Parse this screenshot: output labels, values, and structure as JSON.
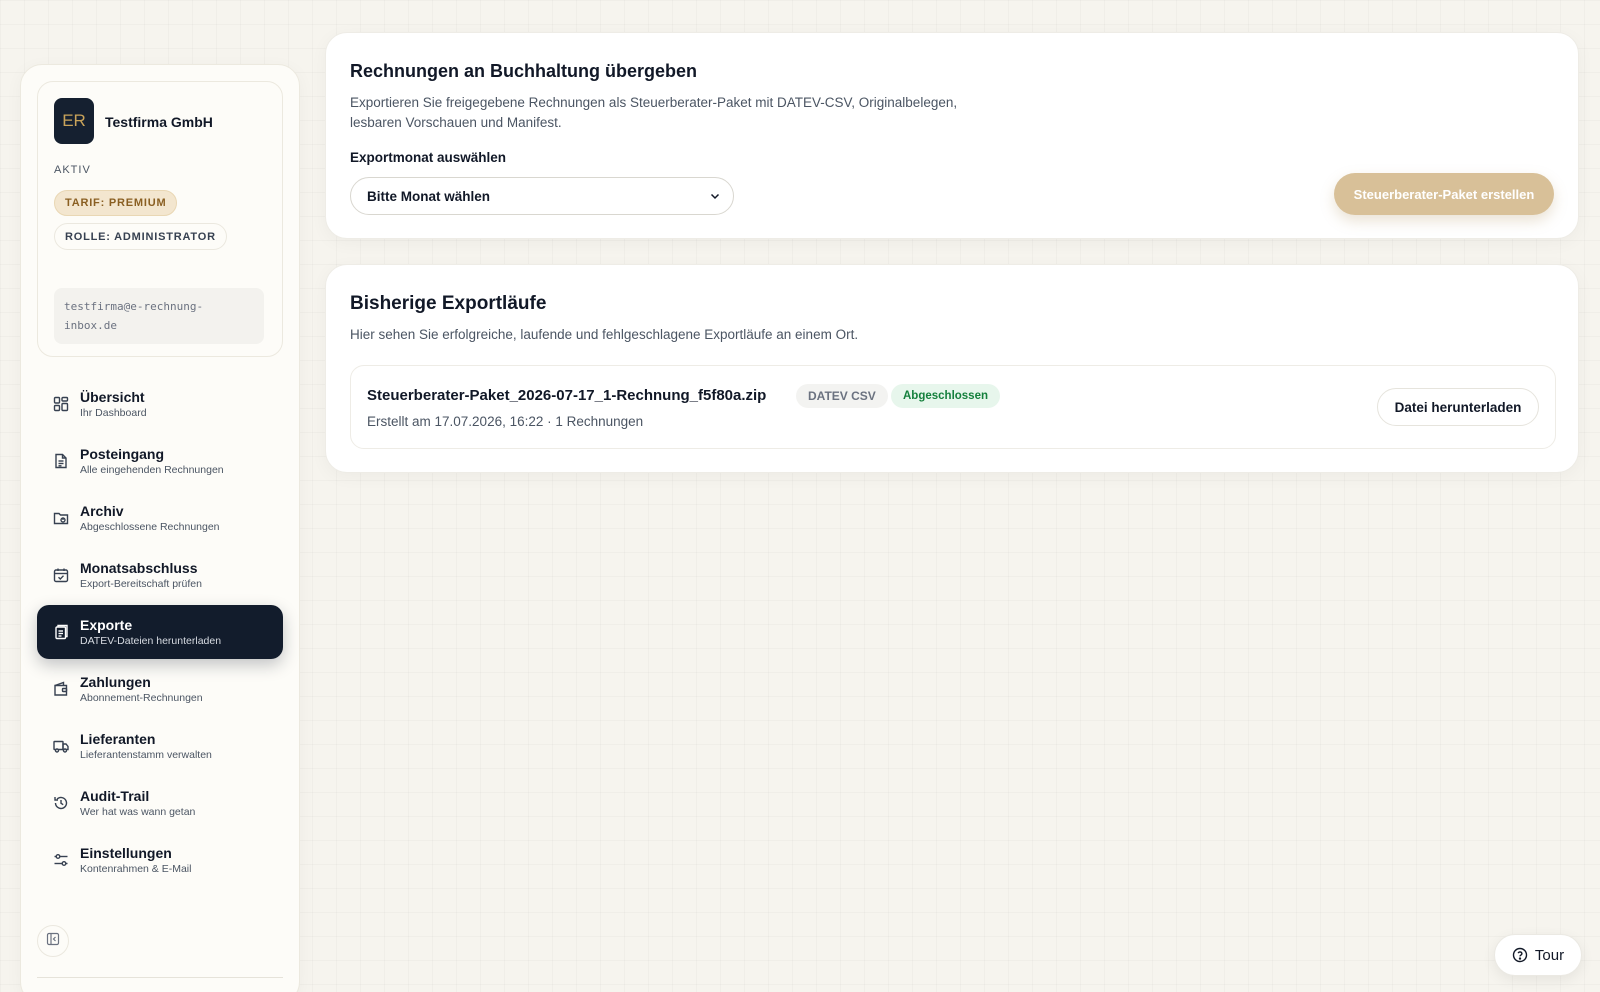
{
  "profile": {
    "initials": "ER",
    "company": "Testfirma GmbH",
    "status": "AKTIV",
    "tarif": "TARIF: PREMIUM",
    "rolle": "ROLLE: ADMINISTRATOR",
    "email": "testfirma@e-rechnung-inbox.de"
  },
  "nav": [
    {
      "title": "Übersicht",
      "sub": "Ihr Dashboard",
      "icon": "dashboard-icon"
    },
    {
      "title": "Posteingang",
      "sub": "Alle eingehenden Rechnungen",
      "icon": "document-icon"
    },
    {
      "title": "Archiv",
      "sub": "Abgeschlossene Rechnungen",
      "icon": "folder-icon"
    },
    {
      "title": "Monatsabschluss",
      "sub": "Export-Bereitschaft prüfen",
      "icon": "calendar-check-icon"
    },
    {
      "title": "Exporte",
      "sub": "DATEV-Dateien herunterladen",
      "icon": "export-files-icon"
    },
    {
      "title": "Zahlungen",
      "sub": "Abonnement-Rechnungen",
      "icon": "wallet-icon"
    },
    {
      "title": "Lieferanten",
      "sub": "Lieferantenstamm verwalten",
      "icon": "truck-icon"
    },
    {
      "title": "Audit-Trail",
      "sub": "Wer hat was wann getan",
      "icon": "history-icon"
    },
    {
      "title": "Einstellungen",
      "sub": "Kontenrahmen & E-Mail",
      "icon": "sliders-icon"
    }
  ],
  "export_card": {
    "title": "Rechnungen an Buchhaltung übergeben",
    "description": "Exportieren Sie freigegebene Rechnungen als Steuerberater-Paket mit DATEV-CSV, Originalbelegen, lesbaren Vorschauen und Manifest.",
    "month_label": "Exportmonat auswählen",
    "month_value": "Bitte Monat wählen",
    "create_button": "Steuerberater-Paket erstellen"
  },
  "history_card": {
    "title": "Bisherige Exportläufe",
    "description": "Hier sehen Sie erfolgreiche, laufende und fehlgeschlagene Exportläufe an einem Ort.",
    "runs": [
      {
        "filename": "Steuerberater-Paket_2026-07-17_1-Rechnung_f5f80a.zip",
        "type": "DATEV CSV",
        "status": "Abgeschlossen",
        "meta": "Erstellt am 17.07.2026, 16:22 · 1 Rechnungen",
        "download_label": "Datei herunterladen"
      }
    ]
  },
  "tour_label": "Tour",
  "colors": {
    "accent_dark": "#121c2c",
    "accent_gold": "#d8c098",
    "success": "#15803d"
  }
}
